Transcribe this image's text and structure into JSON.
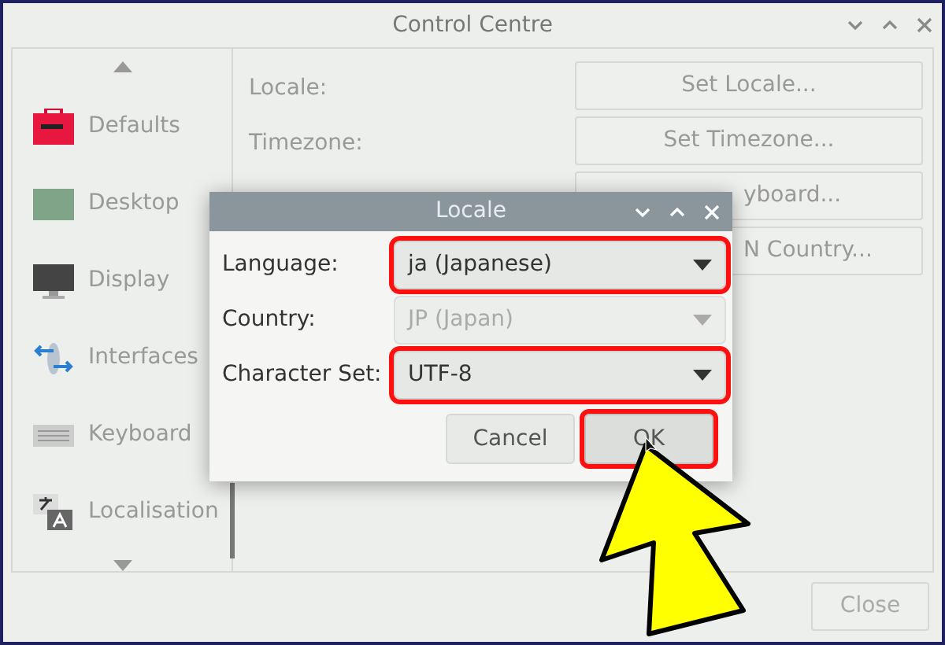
{
  "window": {
    "title": "Control Centre"
  },
  "sidebar": {
    "items": [
      {
        "label": "Defaults",
        "kind": "toolbox"
      },
      {
        "label": "Desktop",
        "kind": "desktop"
      },
      {
        "label": "Display",
        "kind": "monitor"
      },
      {
        "label": "Interfaces",
        "kind": "interfaces"
      },
      {
        "label": "Keyboard",
        "kind": "keyboard"
      },
      {
        "label": "Localisation",
        "kind": "translate"
      }
    ]
  },
  "settings": [
    {
      "label": "Locale:",
      "button": "Set Locale..."
    },
    {
      "label": "Timezone:",
      "button": "Set Timezone..."
    },
    {
      "button": "yboard..."
    },
    {
      "button": "N Country..."
    }
  ],
  "close_button": "Close",
  "dialog": {
    "title": "Locale",
    "fields": [
      {
        "label": "Language:",
        "value": "ja (Japanese)",
        "disabled": false,
        "highlighted": true
      },
      {
        "label": "Country:",
        "value": "JP (Japan)",
        "disabled": true,
        "highlighted": false
      },
      {
        "label": "Character Set:",
        "value": "UTF-8",
        "disabled": false,
        "highlighted": true
      }
    ],
    "buttons": [
      {
        "label": "Cancel",
        "highlighted": false
      },
      {
        "label": "OK",
        "highlighted": true
      }
    ]
  }
}
